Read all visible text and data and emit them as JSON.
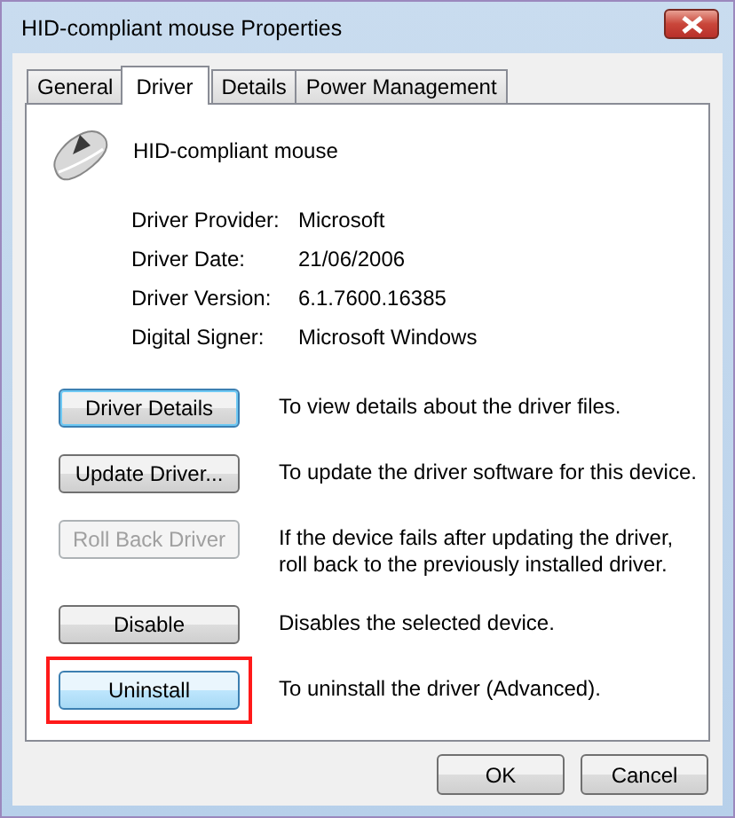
{
  "window": {
    "title": "HID-compliant mouse Properties"
  },
  "tabs": [
    {
      "label": "General",
      "selected": false
    },
    {
      "label": "Driver",
      "selected": true
    },
    {
      "label": "Details",
      "selected": false
    },
    {
      "label": "Power Management",
      "selected": false
    }
  ],
  "device": {
    "name": "HID-compliant mouse"
  },
  "properties": [
    {
      "label": "Driver Provider:",
      "value": "Microsoft"
    },
    {
      "label": "Driver Date:",
      "value": "21/06/2006"
    },
    {
      "label": "Driver Version:",
      "value": "6.1.7600.16385"
    },
    {
      "label": "Digital Signer:",
      "value": "Microsoft Windows"
    }
  ],
  "actions": [
    {
      "button": "Driver Details",
      "description": "To view details about the driver files.",
      "disabled": false,
      "focused": true,
      "hovered": false,
      "marked": false
    },
    {
      "button": "Update Driver...",
      "description": "To update the driver software for this device.",
      "disabled": false,
      "focused": false,
      "hovered": false,
      "marked": false
    },
    {
      "button": "Roll Back Driver",
      "description": "If the device fails after updating the driver, roll back to the previously installed driver.",
      "disabled": true,
      "focused": false,
      "hovered": false,
      "marked": false
    },
    {
      "button": "Disable",
      "description": "Disables the selected device.",
      "disabled": false,
      "focused": false,
      "hovered": false,
      "marked": false
    },
    {
      "button": "Uninstall",
      "description": "To uninstall the driver (Advanced).",
      "disabled": false,
      "focused": false,
      "hovered": true,
      "marked": true
    }
  ],
  "footer_buttons": [
    "OK",
    "Cancel"
  ]
}
